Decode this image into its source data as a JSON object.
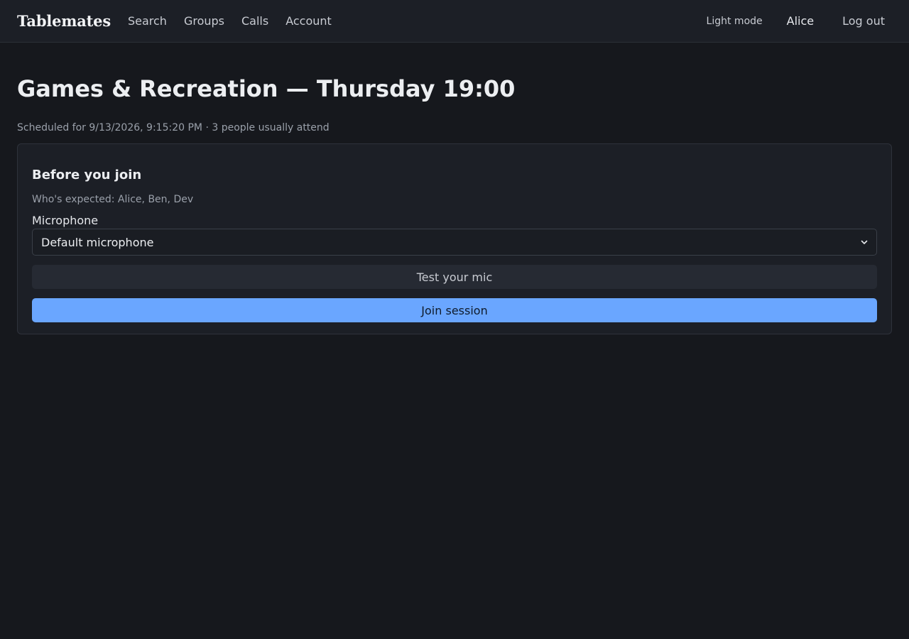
{
  "header": {
    "brand": "Tablemates",
    "nav": [
      "Search",
      "Groups",
      "Calls",
      "Account"
    ],
    "theme_toggle": "Light mode",
    "user": "Alice",
    "logout": "Log out"
  },
  "session": {
    "title": "Games & Recreation — Thursday 19:00",
    "subtitle": "Scheduled for 9/13/2026, 9:15:20 PM · 3 people usually attend"
  },
  "prejoin": {
    "heading": "Before you join",
    "expected": "Who's expected: Alice, Ben, Dev",
    "mic_label": "Microphone",
    "mic_selected": "Default microphone",
    "test_button": "Test your mic",
    "join_button": "Join session"
  },
  "colors": {
    "accent": "#6aa6ff",
    "background": "#16181d",
    "surface": "#1c1f26"
  }
}
